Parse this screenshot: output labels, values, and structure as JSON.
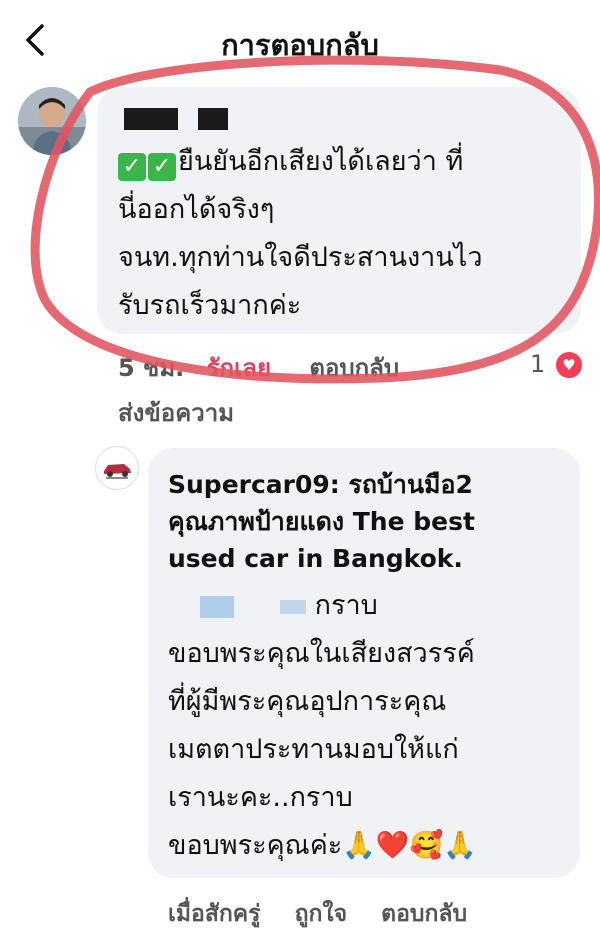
{
  "header": {
    "title": "การตอบกลับ",
    "back_icon": "chevron-left-icon"
  },
  "comment1": {
    "text_line1": "ยืนยันอีกเสียงได้เลยว่า ที่",
    "text_line2": "นี่ออกได้จริงๆ",
    "text_line3": "จนท.ทุกท่านใจดีประสานงานไว",
    "text_line4": "รับรถเร็วมากค่ะ",
    "time": "5 ชม.",
    "love_label": "รักเลย",
    "reply_label": "ตอบกลับ",
    "send_message_label": "ส่งข้อความ",
    "reaction_count": "1",
    "reaction_icon": "heart-icon",
    "accent": "#d9445c"
  },
  "comment2": {
    "name_line1": "Supercar09: รถบ้านมือ2",
    "name_line2": "คุณภาพป้ายแดง The best",
    "name_line3": "used car in Bangkok.",
    "text_line1": "กราบ",
    "text_line2": "ขอบพระคุณในเสียงสวรรค์",
    "text_line3": "ที่ผู้มีพระคุณอุปการะคุณ",
    "text_line4": "เมตตาประทานมอบให้แก่",
    "text_line5": "เรานะคะ..กราบ",
    "text_line6": "ขอบพระคุณค่ะ",
    "emoji": "🙏❤️🥰🙏",
    "time": "เมื่อสักครู่",
    "like_label": "ถูกใจ",
    "reply_label": "ตอบกลับ"
  },
  "colors": {
    "bubble": "#f0f2f5",
    "annotation_ring": "#e0545f",
    "heart": "#f33e58"
  }
}
